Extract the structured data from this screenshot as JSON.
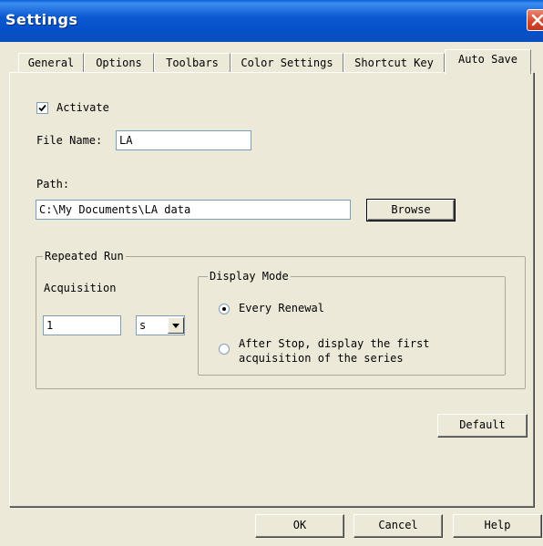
{
  "window": {
    "title": "Settings",
    "close_icon": "close-icon"
  },
  "tabs": [
    {
      "label": "General",
      "active": false
    },
    {
      "label": "Options",
      "active": false
    },
    {
      "label": "Toolbars",
      "active": false
    },
    {
      "label": "Color Settings",
      "active": false
    },
    {
      "label": "Shortcut Key",
      "active": false
    },
    {
      "label": "Auto Save",
      "active": true
    }
  ],
  "auto_save": {
    "activate": {
      "label": "Activate",
      "checked": true
    },
    "file_name": {
      "label": "File Name:",
      "value": "LA"
    },
    "path": {
      "label": "Path:",
      "value": "C:\\My Documents\\LA data"
    },
    "browse_label": "Browse",
    "repeated_run": {
      "title": "Repeated Run",
      "acquisition_label": "Acquisition",
      "acquisition_value": "1",
      "unit_value": "s"
    },
    "display_mode": {
      "title": "Display Mode",
      "options": [
        {
          "label": "Every Renewal",
          "selected": true
        },
        {
          "label_line1": "After Stop, display the first",
          "label_line2": "acquisition of the series",
          "selected": false
        }
      ]
    },
    "default_label": "Default"
  },
  "footer": {
    "ok_label": "OK",
    "cancel_label": "Cancel",
    "help_label": "Help"
  }
}
